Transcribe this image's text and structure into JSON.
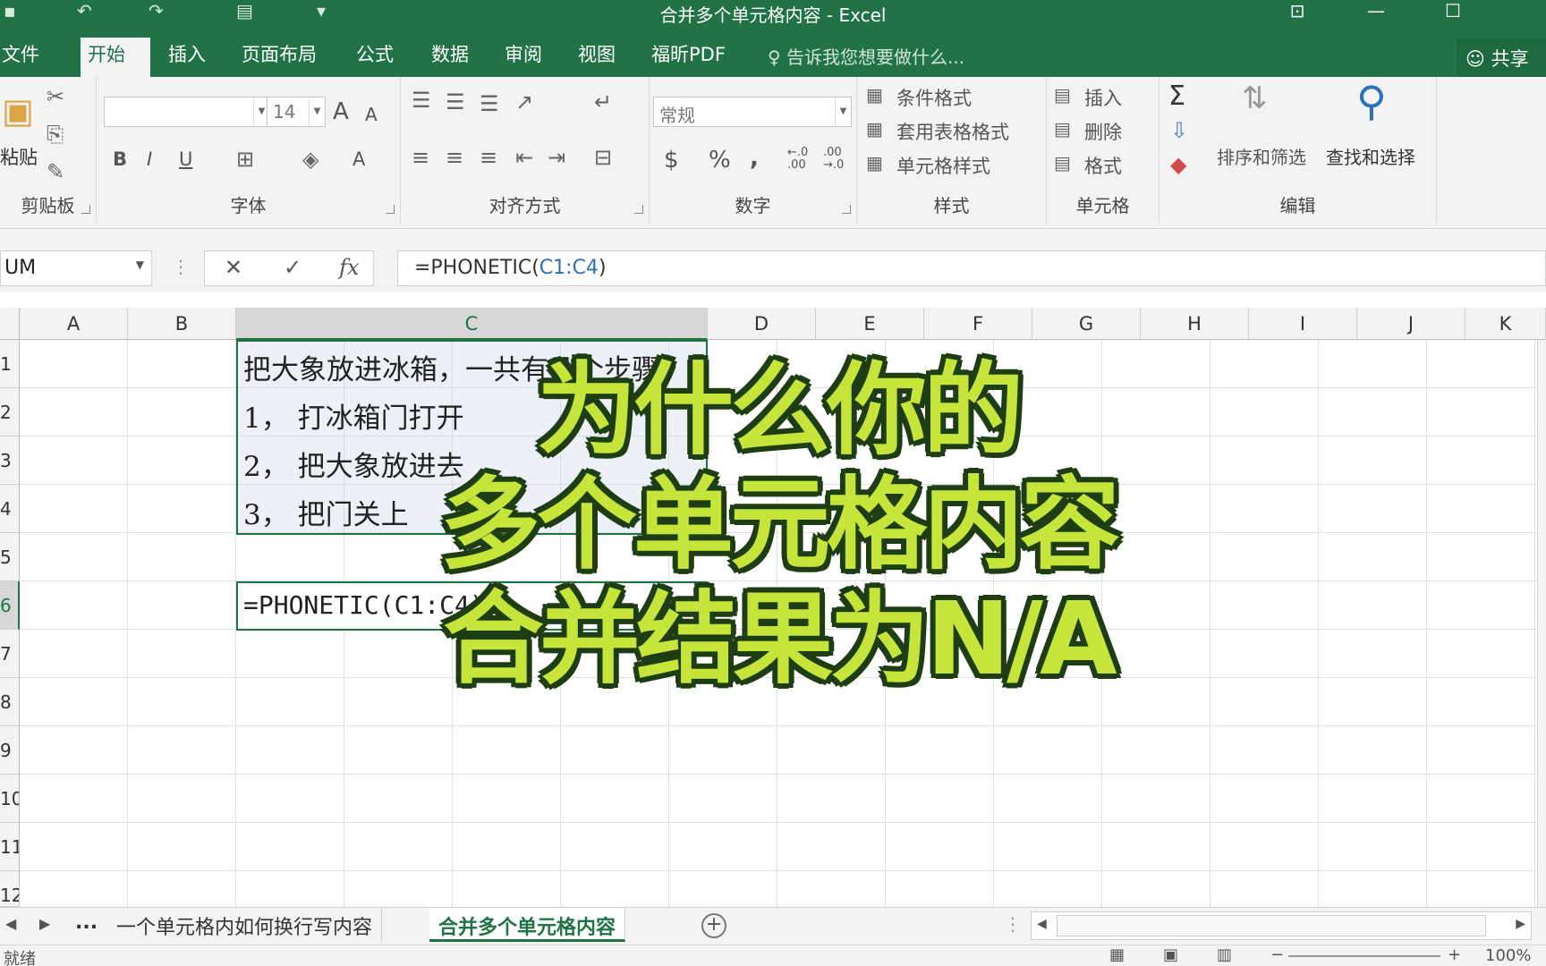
{
  "window": {
    "title": "合并多个单元格内容 - Excel"
  },
  "tabs": [
    "文件",
    "开始",
    "插入",
    "页面布局",
    "公式",
    "数据",
    "审阅",
    "视图",
    "福昕PDF"
  ],
  "tell_me": "告诉我您想要做什么...",
  "share": "共享",
  "ribbon": {
    "clipboard": {
      "paste": "粘贴",
      "label": "剪贴板"
    },
    "font": {
      "size": "14",
      "bold": "B",
      "italic": "I",
      "underline": "U",
      "grow": "A",
      "shrink": "A",
      "color": "A",
      "label": "字体"
    },
    "alignment": {
      "label": "对齐方式"
    },
    "number": {
      "format": "常规",
      "currency": "$",
      "percent": "%",
      "comma": ",",
      "inc_decimal": "←.0 .00",
      "dec_decimal": ".00 →.0",
      "label": "数字"
    },
    "styles": {
      "conditional": "条件格式",
      "table": "套用表格格式",
      "cell_styles": "单元格样式",
      "label": "样式"
    },
    "cells": {
      "insert": "插入",
      "delete": "删除",
      "format": "格式",
      "label": "单元格"
    },
    "editing": {
      "sum": "Σ",
      "sort": "排序和筛选",
      "find": "查找和选择",
      "label": "编辑"
    }
  },
  "formula_bar": {
    "name_box": "UM",
    "cancel": "✕",
    "enter": "✓",
    "fx": "fx",
    "formula_prefix": "=PHONETIC(",
    "formula_ref": "C1:C4",
    "formula_suffix": ")"
  },
  "columns": [
    "A",
    "B",
    "C",
    "D",
    "E",
    "F",
    "G",
    "H",
    "I",
    "J",
    "K"
  ],
  "rows": [
    "1",
    "2",
    "3",
    "4",
    "5",
    "6",
    "7",
    "8",
    "9",
    "10",
    "11",
    "12"
  ],
  "cells": {
    "c1": "把大象放进冰箱，一共有几个步骤?",
    "c2": "1，  打冰箱门打开",
    "c3": "2，  把大象放进去",
    "c4": "3，  把门关上",
    "c6": "=PHONETIC(C1:C4)"
  },
  "overlay": [
    "为什么你的",
    "多个单元格内容",
    "合并结果为N/A"
  ],
  "sheets": {
    "more": "...",
    "tab1": "一个单元格内如何换行写内容",
    "tab2": "合并多个单元格内容",
    "add": "+"
  },
  "status": {
    "left": "就绪",
    "zoom": "100%"
  },
  "colors": {
    "excel_green": "#217346",
    "overlay_fill": "#c5e53b",
    "overlay_outline": "#1f3d12"
  }
}
